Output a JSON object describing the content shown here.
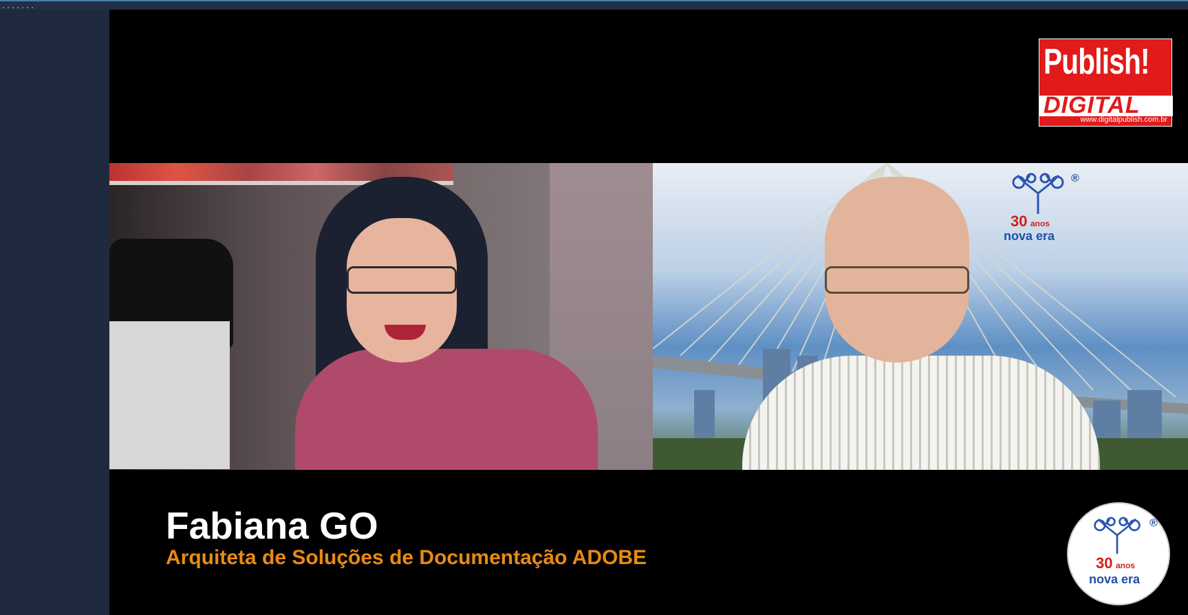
{
  "window": {
    "top_bar_dots": "......."
  },
  "overlay": {
    "publish_logo": {
      "title": "Publish!",
      "subtitle": "DIGITAL",
      "url": "www.digitalpublish.com.br"
    },
    "nova_era_logo": {
      "number": "30",
      "anos": "anos",
      "name": "nova era",
      "registered": "®"
    }
  },
  "lower_third": {
    "name": "Fabiana GO",
    "role": "Arquiteta de Soluções de Documentação ADOBE"
  },
  "colors": {
    "accent_orange": "#e88a16",
    "publish_red": "#e11a1a",
    "nova_blue": "#1f4fa8",
    "nova_red": "#d0201a"
  }
}
